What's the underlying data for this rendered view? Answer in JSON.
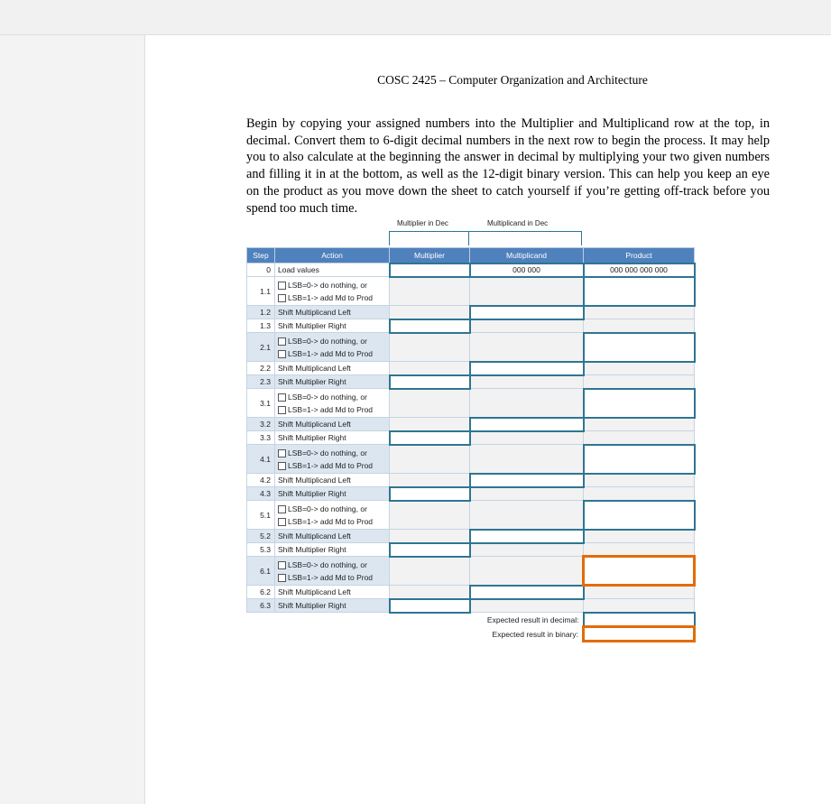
{
  "document": {
    "title": "COSC 2425 – Computer Organization and Architecture",
    "instructions": "Begin by copying your assigned numbers into the Multiplier and Multiplicand row at the top, in decimal. Convert them to 6-digit decimal numbers in the next row to begin the process. It may help you to also calculate at the beginning the answer in decimal by multiplying your two given numbers and filling it in at the bottom, as well as the 12-digit binary version. This can help you keep an eye on the product as you move down the sheet to catch yourself if you’re getting off-track before you spend too much time."
  },
  "inputs": {
    "multiplier_dec_label": "Multiplier in Dec",
    "multiplicand_dec_label": "Multiplicand in Dec"
  },
  "table": {
    "headers": {
      "step": "Step",
      "action": "Action",
      "multiplier": "Multiplier",
      "multiplicand": "Multiplicand",
      "product": "Product"
    },
    "load_step": "0",
    "load_action": "Load values",
    "load_multiplicand": "000 000",
    "load_product": "000 000 000 000",
    "options": {
      "do_nothing": "LSB=0-> do nothing, or",
      "add": "LSB=1-> add Md to Prod"
    },
    "shift_left": "Shift Multiplicand Left",
    "shift_right": "Shift Multiplier Right",
    "steps": [
      {
        "a": "1.1",
        "b": "1.2",
        "c": "1.3"
      },
      {
        "a": "2.1",
        "b": "2.2",
        "c": "2.3"
      },
      {
        "a": "3.1",
        "b": "3.2",
        "c": "3.3"
      },
      {
        "a": "4.1",
        "b": "4.2",
        "c": "4.3"
      },
      {
        "a": "5.1",
        "b": "5.2",
        "c": "5.3"
      },
      {
        "a": "6.1",
        "b": "6.2",
        "c": "6.3"
      }
    ],
    "expected_decimal_label": "Expected result in decimal:",
    "expected_binary_label": "Expected result in binary:"
  },
  "colors": {
    "header_blue": "#4f81bd",
    "border_teal": "#2e7593",
    "highlight_orange": "#e36c0a",
    "stripe": "#dce6f1"
  }
}
